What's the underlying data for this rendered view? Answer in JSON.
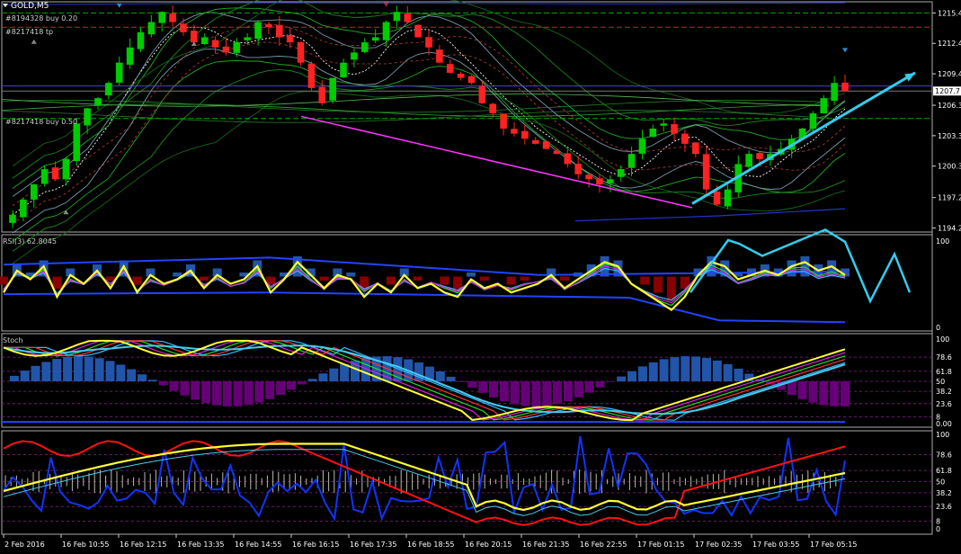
{
  "header": {
    "symbol": "GOLD,M5",
    "order_1": "#8194328 buy 0.20",
    "order_2": "#8217418 tp",
    "order_3": "#8217418 buy 0.50"
  },
  "colors": {
    "background": "#000000",
    "candle_up": "#00cc00",
    "candle_down": "#ff2222",
    "price_tag_bg": "#ffffff",
    "trend_magenta": "#ff33ff",
    "arrow_cyan": "#33ccee",
    "osc_yellow": "#ffff33",
    "hist_blue": "#2255aa",
    "hist_maroon": "#880000",
    "hist_purple": "#660077",
    "line_blue": "#1133ff",
    "line_red": "#ff1111"
  },
  "chart_data": {
    "type": "line",
    "title": "GOLD,M5",
    "x_labels": [
      "2 Feb 2016",
      "16 Feb 10:55",
      "16 Feb 12:15",
      "16 Feb 13:35",
      "16 Feb 14:55",
      "16 Feb 16:15",
      "16 Feb 17:35",
      "16 Feb 18:55",
      "16 Feb 20:15",
      "16 Feb 21:35",
      "16 Feb 22:55",
      "17 Feb 01:15",
      "17 Feb 02:35",
      "17 Feb 03:55",
      "17 Feb 05:15"
    ],
    "price_axis": {
      "ylim": [
        1193.8,
        1216.5
      ],
      "ticks": [
        "1215.4",
        "1212.4",
        "1209.4",
        "1206.3",
        "1203.3",
        "1200.3",
        "1197.2",
        "1194.2"
      ],
      "current_price_label": "1207.7",
      "current_price": 1207.7,
      "close_series": [
        1195.5,
        1197.0,
        1198.5,
        1200.0,
        1199.0,
        1201.0,
        1204.5,
        1206.0,
        1207.0,
        1208.5,
        1210.5,
        1212.0,
        1213.5,
        1214.5,
        1215.5,
        1214.5,
        1213.5,
        1212.5,
        1213.0,
        1212.0,
        1211.5,
        1212.5,
        1213.0,
        1214.5,
        1214.0,
        1213.0,
        1212.5,
        1210.5,
        1208.0,
        1206.5,
        1209.0,
        1210.5,
        1211.5,
        1212.5,
        1213.0,
        1214.5,
        1215.5,
        1214.5,
        1213.0,
        1212.0,
        1210.5,
        1209.5,
        1209.0,
        1208.5,
        1206.5,
        1205.5,
        1204.0,
        1203.5,
        1203.0,
        1202.5,
        1202.0,
        1201.5,
        1200.5,
        1199.5,
        1199.0,
        1198.5,
        1199.0,
        1200.0,
        1201.5,
        1203.0,
        1204.0,
        1204.5,
        1203.5,
        1202.5,
        1201.5,
        1198.0,
        1196.5,
        1198.0,
        1200.5,
        1201.5,
        1201.0,
        1201.5,
        1202.0,
        1203.0,
        1204.0,
        1205.5,
        1207.0,
        1208.5,
        1207.7
      ],
      "order_levels": [
        1215.4,
        1214.0,
        1205.0
      ],
      "magenta_trendline": {
        "from": [
          335,
          1205.2
        ],
        "to": [
          770,
          1196.2
        ]
      },
      "cyan_arrow_price": {
        "from": [
          770,
          1196.6
        ],
        "to": [
          1018,
          1209.5
        ]
      }
    },
    "rsi": {
      "label": "RSI(3) 62.8045",
      "ylim": [
        0,
        100
      ],
      "ticks": [
        "100",
        "0"
      ],
      "series": [
        40,
        65,
        55,
        70,
        35,
        60,
        50,
        65,
        45,
        70,
        40,
        60,
        50,
        55,
        65,
        45,
        60,
        50,
        55,
        70,
        40,
        55,
        75,
        60,
        45,
        60,
        55,
        35,
        50,
        40,
        60,
        45,
        50,
        40,
        35,
        55,
        45,
        50,
        40,
        45,
        50,
        60,
        45,
        55,
        65,
        75,
        70,
        50,
        40,
        30,
        20,
        35,
        60,
        75,
        70,
        55,
        60,
        65,
        60,
        70,
        75,
        65,
        70,
        60
      ]
    },
    "stochastic": {
      "label": "Stoch",
      "ylim": [
        0,
        100
      ],
      "ticks": [
        "100",
        "78.6",
        "61.8",
        "50",
        "38.2",
        "23.6",
        "8",
        "0.00"
      ]
    },
    "bottom": {
      "ylim": [
        0,
        100
      ],
      "ticks": [
        "100",
        "78.6",
        "61.8",
        "50",
        "38.2",
        "23.6",
        "8",
        "0"
      ]
    }
  }
}
